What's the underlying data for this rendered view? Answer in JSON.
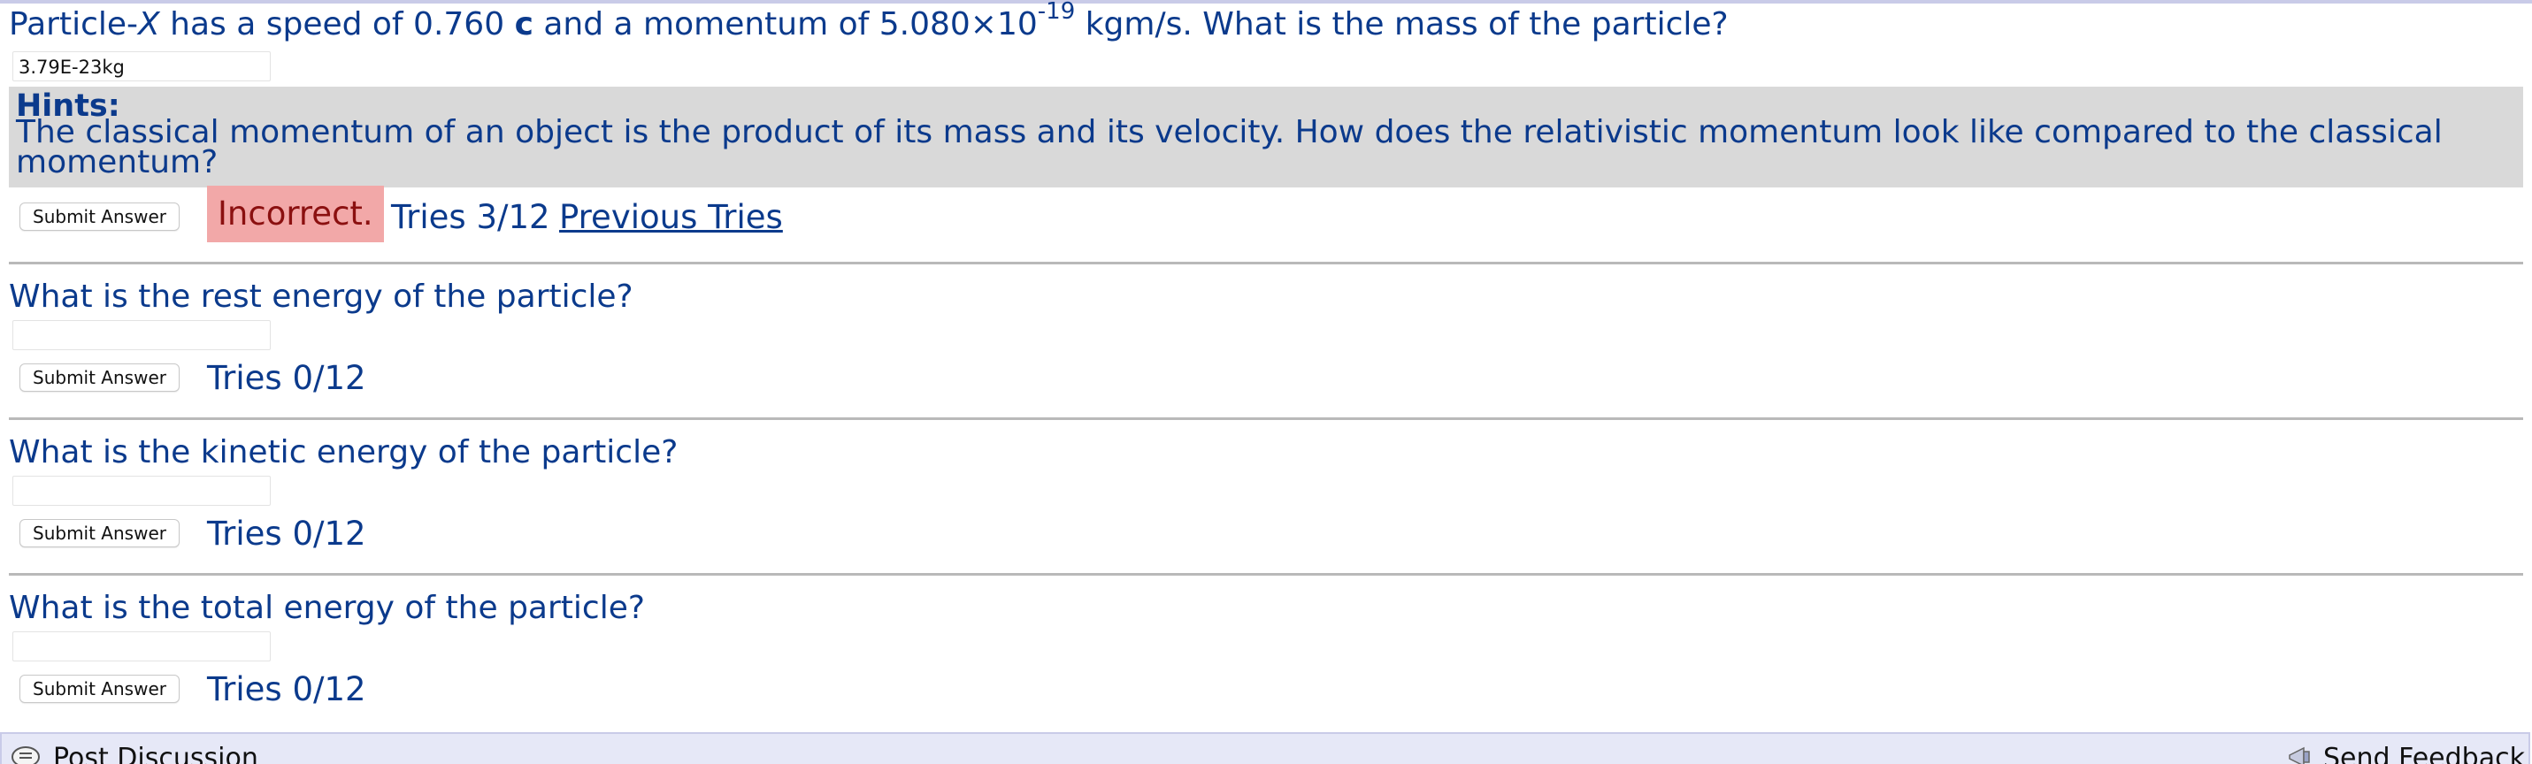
{
  "part1": {
    "question_prefix": "Particle-",
    "question_var": "X",
    "question_mid1": " has a speed of 0.760 ",
    "question_c": "c",
    "question_mid2": " and a momentum of 5.080×10",
    "question_exp": "-19",
    "question_suffix": " kgm/s. What is the mass of the particle?",
    "answer_value": "3.79E-23kg",
    "hints_title": "Hints:",
    "hints_text": "The classical momentum of an object is the product of its mass and its velocity. How does the relativistic momentum look like compared to the classical momentum?",
    "submit_label": "Submit Answer",
    "status": "Incorrect.",
    "tries": "Tries 3/12",
    "previous_tries": "Previous Tries"
  },
  "part2": {
    "question": "What is the rest energy of the particle?",
    "answer_value": "",
    "submit_label": "Submit Answer",
    "tries": "Tries 0/12"
  },
  "part3": {
    "question": "What is the kinetic energy of the particle?",
    "answer_value": "",
    "submit_label": "Submit Answer",
    "tries": "Tries 0/12"
  },
  "part4": {
    "question": "What is the total energy of the particle?",
    "answer_value": "",
    "submit_label": "Submit Answer",
    "tries": "Tries 0/12"
  },
  "footer": {
    "post_discussion": "Post Discussion",
    "send_feedback": "Send Feedback",
    "post_icon": "discussion-icon",
    "feedback_icon": "megaphone-icon"
  },
  "colors": {
    "text": "#0b3a8c",
    "hints_bg": "#d9d9d9",
    "incorrect_bg": "#f2a8a8",
    "incorrect_text": "#8b1010",
    "footer_bg": "#e6e8f7"
  }
}
